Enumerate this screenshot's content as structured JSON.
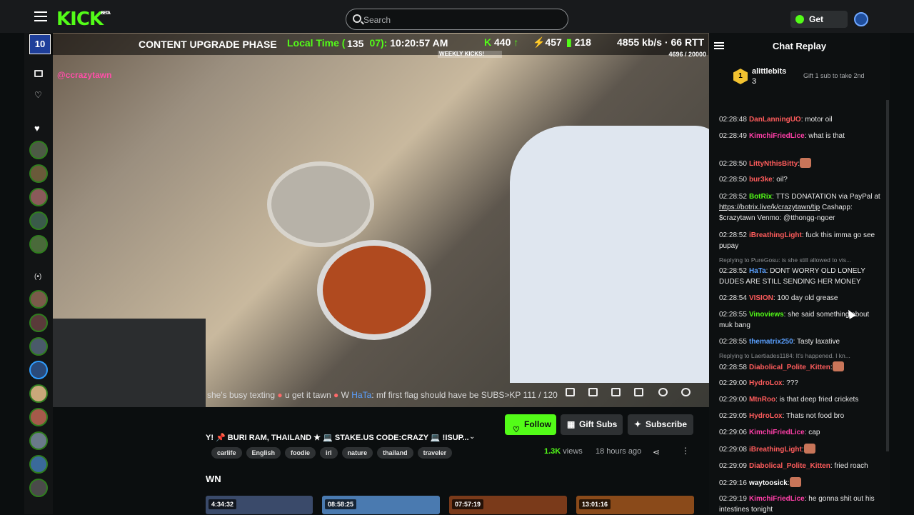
{
  "topbar": {
    "logo": "KICK",
    "logo_sup": "BETA",
    "search_placeholder": "Search",
    "get_kicks_label": "Get KICKs"
  },
  "overlay": {
    "level": "10",
    "title": "CONTENT UPGRADE PHASE",
    "time_label": "Local Time (",
    "time_mid": "07):",
    "time_value": "10:20:57 AM",
    "level_badge": "135",
    "stat_kicks": "440",
    "stat_followers": "457",
    "stat_viewers": "218",
    "stat_bitrate": "4855 kb/s · 66 RTT",
    "weekly_label": "WEEKLY KICKS!",
    "weekly_count": "4696 / 20000",
    "handle": "@ccrazytawn"
  },
  "scrolling_chat": {
    "part1": "she's busy texting",
    "part2": "u get it tawn",
    "part3": "W",
    "part4": "HaTa",
    "part5": ": mf first flag should have be SUBS>KP",
    "part6": "111 / 120"
  },
  "stream": {
    "follow_label": "Follow",
    "gift_label": "Gift Subs",
    "subscribe_label": "Subscribe",
    "title": "Y! 📌 BURI RAM, THAILAND ★ 💻 STAKE.US CODE:CRAZY 💻 !ISUP...",
    "tags": [
      "carlife",
      "English",
      "foodie",
      "irl",
      "nature",
      "thailand",
      "traveler"
    ],
    "views_count": "1.3K",
    "views_label": " views",
    "ago": "18 hours ago",
    "section_heading": "WN"
  },
  "vods": [
    {
      "duration": "4:34:32"
    },
    {
      "duration": "08:58:25"
    },
    {
      "duration": "07:57:19"
    },
    {
      "duration": "13:01:16"
    }
  ],
  "chat": {
    "header": "Chat Replay",
    "pinned": {
      "rank": "1",
      "name": "alittlebits",
      "amount": "3",
      "gift_text": "Gift 1 sub to take 2nd"
    },
    "messages": [
      {
        "ts": "02:28:48",
        "user": "DanLanningUO",
        "user_color": "#ff5c5c",
        "text": ": motor oil"
      },
      {
        "ts": "02:28:49",
        "user": "KimchiFriedLice",
        "user_color": "#ff3fa8",
        "text": ": what is that"
      },
      {
        "ts": "02:28:50",
        "user": "LittyNthisBitty",
        "user_color": "#ff5c5c",
        "text": ":"
      },
      {
        "ts": "02:28:50",
        "user": "bur3ke",
        "user_color": "#ff5c5c",
        "text": ": oil?"
      },
      {
        "ts": "02:28:52",
        "user": "BotRix",
        "user_color": "#53fc18",
        "text": ": TTS DONATATION via PayPal at ",
        "link": "https://botrix.live/k/crazytawn/tip",
        "text2": " Cashapp: $crazytawn Venmo: @tthongg-ngoer"
      },
      {
        "ts": "02:28:52",
        "user": "iBreathingLight",
        "user_color": "#ff5c5c",
        "text": ": fuck this imma go see pupay"
      },
      {
        "ts": "02:28:52",
        "user": "HaTa",
        "user_color": "#5aa0ff",
        "text": ": DONT WORRY OLD LONELY DUDES ARE STILL SENDING HER MONEY"
      },
      {
        "ts": "02:28:54",
        "user": "VISION",
        "user_color": "#ff5c5c",
        "text": ": 100 day old grease"
      },
      {
        "ts": "02:28:55",
        "user": "Vinoviews",
        "user_color": "#53fc18",
        "text": ": she said something about muk bang"
      },
      {
        "ts": "02:28:55",
        "user": "thematrix250",
        "user_color": "#5aa0ff",
        "text": ": Tasty laxative"
      },
      {
        "ts": "02:28:58",
        "user": "Diabolical_Polite_Kitten",
        "user_color": "#ff5c5c",
        "text": ":"
      },
      {
        "ts": "02:29:00",
        "user": "HydroLox",
        "user_color": "#ff5c5c",
        "text": ": ???"
      },
      {
        "ts": "02:29:00",
        "user": "MtnRoo",
        "user_color": "#ff5c5c",
        "text": ": is that deep fried crickets"
      },
      {
        "ts": "02:29:05",
        "user": "HydroLox",
        "user_color": "#ff5c5c",
        "text": ": Thats not food bro"
      },
      {
        "ts": "02:29:06",
        "user": "KimchiFriedLice",
        "user_color": "#ff3fa8",
        "text": ": cap"
      },
      {
        "ts": "02:29:08",
        "user": "iBreathingLight",
        "user_color": "#ff5c5c",
        "text": ":"
      },
      {
        "ts": "02:29:09",
        "user": "Diabolical_Polite_Kitten",
        "user_color": "#ff5c5c",
        "text": ": fried roach"
      },
      {
        "ts": "02:29:16",
        "user": "waytoosick",
        "user_color": "#fff",
        "text": ":"
      },
      {
        "ts": "02:29:19",
        "user": "KimchiFriedLice",
        "user_color": "#ff3fa8",
        "text": ": he gonna shit out his intestines tonight"
      }
    ],
    "replies": [
      {
        "text": "Replying to PureGosu: is she still allowed to vis..."
      },
      {
        "text": "Replying to Laertiades1184: It's happened. I kn..."
      }
    ]
  },
  "colors": {
    "brand": "#53fc18",
    "bg": "#0b0e0f",
    "panel": "#2e3133"
  }
}
